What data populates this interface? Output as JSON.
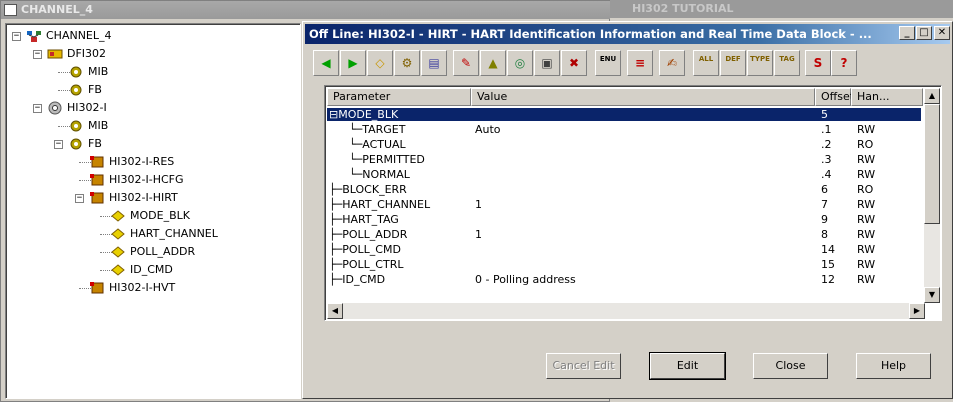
{
  "left_window": {
    "title": "CHANNEL_4",
    "tree": [
      {
        "label": "CHANNEL_4",
        "icon": "network-icon",
        "expanded": true
      },
      {
        "label": "DFI302",
        "icon": "device-icon",
        "expanded": true
      },
      {
        "label": "MIB",
        "icon": "gear-icon"
      },
      {
        "label": "FB",
        "icon": "gear-icon"
      },
      {
        "label": "HI302-I",
        "icon": "device-gear-icon",
        "expanded": true
      },
      {
        "label": "MIB",
        "icon": "gear-icon"
      },
      {
        "label": "FB",
        "icon": "gear-icon",
        "expanded": true
      },
      {
        "label": "HI302-I-RES",
        "icon": "block-icon"
      },
      {
        "label": "HI302-I-HCFG",
        "icon": "block-icon"
      },
      {
        "label": "HI302-I-HIRT",
        "icon": "block-icon",
        "expanded": true
      },
      {
        "label": "MODE_BLK",
        "icon": "param-icon"
      },
      {
        "label": "HART_CHANNEL",
        "icon": "param-icon"
      },
      {
        "label": "POLL_ADDR",
        "icon": "param-icon"
      },
      {
        "label": "ID_CMD",
        "icon": "param-icon"
      },
      {
        "label": "HI302-I-HVT",
        "icon": "block-icon"
      }
    ]
  },
  "background_window": {
    "title": "HI302 TUTORIAL"
  },
  "dialog": {
    "title": "Off Line: HI302-I - HIRT - HART Identification Information and Real Time Data Block - ...",
    "toolbar": [
      {
        "icon": "back-icon",
        "glyph": "◀"
      },
      {
        "icon": "forward-icon",
        "glyph": "▶"
      },
      {
        "icon": "diamond-icon",
        "glyph": "◇"
      },
      {
        "icon": "settings-icon",
        "glyph": "⚙"
      },
      {
        "icon": "edit-block-icon",
        "glyph": "▤"
      },
      {
        "icon": "pen-icon",
        "glyph": "✎"
      },
      {
        "icon": "bell-icon",
        "glyph": "▲"
      },
      {
        "icon": "monitor-icon",
        "glyph": "◎"
      },
      {
        "icon": "display-icon",
        "glyph": "▣"
      },
      {
        "icon": "wizard-icon",
        "glyph": "✖"
      },
      {
        "icon": "enum-icon",
        "glyph": "ENU"
      },
      {
        "icon": "list-icon",
        "glyph": "≡"
      },
      {
        "icon": "write-icon",
        "glyph": "✍"
      },
      {
        "icon": "all-icon",
        "glyph": "ALL"
      },
      {
        "icon": "default-icon",
        "glyph": "DEF"
      },
      {
        "icon": "type-icon",
        "glyph": "TYPE"
      },
      {
        "icon": "tag-icon",
        "glyph": "TAG"
      },
      {
        "icon": "s-icon",
        "glyph": "S"
      },
      {
        "icon": "help-topic-icon",
        "glyph": "?"
      }
    ],
    "columns": [
      "Parameter",
      "Value",
      "Offset",
      "Han..."
    ],
    "rows": [
      {
        "param": "MODE_BLK",
        "value": "",
        "offset": "5",
        "handling": "",
        "selected": true,
        "expander": "−",
        "indent": 0
      },
      {
        "param": "TARGET",
        "value": "Auto",
        "offset": ".1",
        "handling": "RW",
        "indent": 1
      },
      {
        "param": "ACTUAL",
        "value": "",
        "offset": ".2",
        "handling": "RO",
        "indent": 1
      },
      {
        "param": "PERMITTED",
        "value": "",
        "offset": ".3",
        "handling": "RW",
        "indent": 1
      },
      {
        "param": "NORMAL",
        "value": "",
        "offset": ".4",
        "handling": "RW",
        "indent": 1
      },
      {
        "param": "BLOCK_ERR",
        "value": "",
        "offset": "6",
        "handling": "RO",
        "indent": 0
      },
      {
        "param": "HART_CHANNEL",
        "value": "1",
        "offset": "7",
        "handling": "RW",
        "indent": 0
      },
      {
        "param": "HART_TAG",
        "value": "",
        "offset": "9",
        "handling": "RW",
        "indent": 0
      },
      {
        "param": "POLL_ADDR",
        "value": "1",
        "offset": "8",
        "handling": "RW",
        "indent": 0
      },
      {
        "param": "POLL_CMD",
        "value": "",
        "offset": "14",
        "handling": "RW",
        "indent": 0
      },
      {
        "param": "POLL_CTRL",
        "value": "",
        "offset": "15",
        "handling": "RW",
        "indent": 0
      },
      {
        "param": "ID_CMD",
        "value": "0 - Polling address",
        "offset": "12",
        "handling": "RW",
        "indent": 0
      }
    ],
    "buttons": {
      "cancel_edit": "Cancel Edit",
      "edit": "Edit",
      "close": "Close",
      "help": "Help"
    }
  },
  "colors": {
    "title_active": "#0a246a",
    "selection": "#0a246a",
    "face": "#d4d0c8"
  }
}
